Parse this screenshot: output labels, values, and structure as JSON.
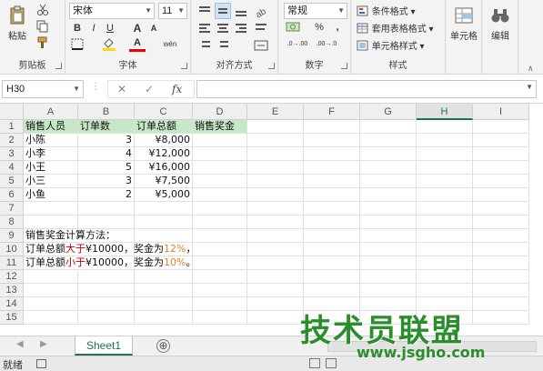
{
  "ribbon": {
    "clipboard": {
      "paste_label": "粘贴",
      "group_label": "剪贴板"
    },
    "font": {
      "name": "宋体",
      "size": "11",
      "group_label": "字体",
      "bold": "B",
      "italic": "I",
      "underline": "U",
      "text_color_letter": "A",
      "grow_letter": "A",
      "shrink_letter": "A",
      "phonetic": "wén"
    },
    "alignment": {
      "group_label": "对齐方式"
    },
    "number": {
      "format": "常规",
      "group_label": "数字",
      "percent": "%",
      "comma": ",",
      "inc_decimal": ".0→.00",
      "dec_decimal": ".00→.0"
    },
    "styles": {
      "conditional": "条件格式",
      "table_format": "套用表格格式",
      "cell_styles": "单元格样式",
      "group_label": "样式"
    },
    "cells": {
      "label": "单元格"
    },
    "editing": {
      "label": "编辑"
    }
  },
  "formula_bar": {
    "name_box": "H30",
    "cancel": "✕",
    "enter": "✓",
    "fx": "fx",
    "content": ""
  },
  "columns": [
    "A",
    "B",
    "C",
    "D",
    "E",
    "F",
    "G",
    "H",
    "I"
  ],
  "selected_column": "H",
  "rows": [
    "1",
    "2",
    "3",
    "4",
    "5",
    "6",
    "7",
    "8",
    "9",
    "10",
    "11",
    "12",
    "13",
    "14",
    "15"
  ],
  "table": {
    "headers": [
      "销售人员",
      "订单数",
      "订单总额",
      "销售奖金"
    ],
    "records": [
      {
        "name": "小陈",
        "orders": "3",
        "total": "¥8,000"
      },
      {
        "name": "小李",
        "orders": "4",
        "total": "¥12,000"
      },
      {
        "name": "小王",
        "orders": "5",
        "total": "¥16,000"
      },
      {
        "name": "小三",
        "orders": "3",
        "total": "¥7,500"
      },
      {
        "name": "小鱼",
        "orders": "2",
        "total": "¥5,000"
      }
    ]
  },
  "notes": {
    "title": "销售奖金计算方法：",
    "rule1": {
      "prefix": "订单总额",
      "op": "大于",
      "mid": "¥10000，奖金为",
      "rate": "12%",
      "suffix": "，"
    },
    "rule2": {
      "prefix": "订单总额",
      "op": "小于",
      "mid": "¥10000，奖金为",
      "rate": "10%",
      "suffix": "。"
    }
  },
  "sheet_tabs": [
    "Sheet1"
  ],
  "add_sheet": "⊕",
  "status": {
    "ready": "就绪"
  },
  "watermark": {
    "main": "技术员联盟",
    "url": "www.jsgho.com"
  },
  "colors": {
    "accent": "#217346",
    "header_fill": "#c6e8c6",
    "red": "#c00000",
    "orange": "#e0822d"
  }
}
